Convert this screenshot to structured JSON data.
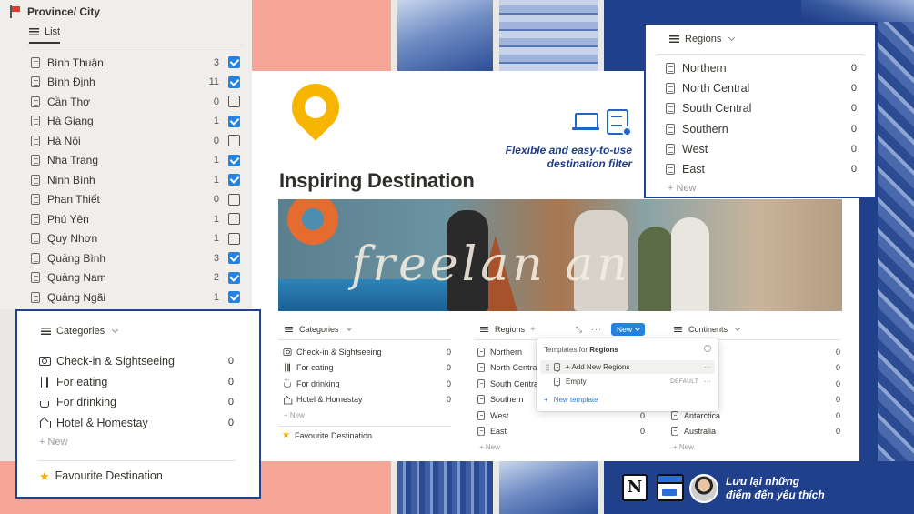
{
  "sidebar": {
    "title": "Province/ City",
    "tab": "List",
    "items": [
      {
        "name": "Bình Thuận",
        "count": "3",
        "checked": true
      },
      {
        "name": "Bình Định",
        "count": "11",
        "checked": true
      },
      {
        "name": "Cần Thơ",
        "count": "0",
        "checked": false
      },
      {
        "name": "Hà Giang",
        "count": "1",
        "checked": true
      },
      {
        "name": "Hà Nội",
        "count": "0",
        "checked": false
      },
      {
        "name": "Nha Trang",
        "count": "1",
        "checked": true
      },
      {
        "name": "Ninh Bình",
        "count": "1",
        "checked": true
      },
      {
        "name": "Phan Thiết",
        "count": "0",
        "checked": false
      },
      {
        "name": "Phú Yên",
        "count": "1",
        "checked": false
      },
      {
        "name": "Quy Nhơn",
        "count": "1",
        "checked": false
      },
      {
        "name": "Quảng Bình",
        "count": "3",
        "checked": true
      },
      {
        "name": "Quảng Nam",
        "count": "2",
        "checked": true
      },
      {
        "name": "Quảng Ngãi",
        "count": "1",
        "checked": true
      }
    ]
  },
  "categories_panel": {
    "title": "Categories",
    "items": [
      {
        "icon": "camera-icon",
        "name": "Check-in & Sightseeing",
        "count": "0"
      },
      {
        "icon": "fork-icon",
        "name": "For eating",
        "count": "0"
      },
      {
        "icon": "cup-icon",
        "name": "For drinking",
        "count": "0"
      },
      {
        "icon": "house-icon",
        "name": "Hotel & Homestay",
        "count": "0"
      }
    ],
    "new_label": "+ New",
    "favourite": "Favourite Destination"
  },
  "card": {
    "title": "Inspiring Destination",
    "tagline_1": "Flexible and easy-to-use",
    "tagline_2": "destination filter",
    "banner_text": "freelan     an"
  },
  "columns": {
    "categories": {
      "title": "Categories",
      "items": [
        {
          "icon": "camera-icon",
          "name": "Check-in & Sightseeing",
          "count": "0"
        },
        {
          "icon": "fork-icon",
          "name": "For eating",
          "count": "0"
        },
        {
          "icon": "cup-icon",
          "name": "For drinking",
          "count": "0"
        },
        {
          "icon": "house-icon",
          "name": "Hotel & Homestay",
          "count": "0"
        }
      ],
      "new_label": "+ New",
      "favourite": "Favourite Destination"
    },
    "regions": {
      "title": "Regions",
      "plus": "+",
      "expand": "⤡",
      "more": "···",
      "new_button": "New",
      "items": [
        {
          "name": "Northern",
          "count": ""
        },
        {
          "name": "North Central",
          "count": ""
        },
        {
          "name": "South Central",
          "count": ""
        },
        {
          "name": "Southern",
          "count": ""
        },
        {
          "name": "West",
          "count": "0"
        },
        {
          "name": "East",
          "count": "0"
        }
      ],
      "new_label": "+ New"
    },
    "continents": {
      "title": "Continents",
      "items": [
        {
          "name": "",
          "count": "0"
        },
        {
          "name": "",
          "count": "0"
        },
        {
          "name": "",
          "count": "0"
        },
        {
          "name": "",
          "count": "0"
        },
        {
          "name": "Antarctica",
          "count": "0"
        },
        {
          "name": "Australia",
          "count": "0"
        }
      ],
      "new_label": "+ New"
    }
  },
  "templates": {
    "heading_prefix": "Templates for",
    "heading_target": "Regions",
    "help": "?",
    "rows": [
      {
        "name": "+ Add New Regions",
        "badge": "",
        "dots": "···"
      },
      {
        "name": "Empty",
        "badge": "DEFAULT",
        "dots": "···"
      }
    ],
    "new_template": "New template",
    "new_plus": "+"
  },
  "regions_panel": {
    "title": "Regions",
    "items": [
      {
        "name": "Northern",
        "count": "0"
      },
      {
        "name": "North Central",
        "count": "0"
      },
      {
        "name": "South Central",
        "count": "0"
      },
      {
        "name": "Southern",
        "count": "0"
      },
      {
        "name": "West",
        "count": "0"
      },
      {
        "name": "East",
        "count": "0"
      }
    ],
    "new_label": "+ New"
  },
  "footer": {
    "notion_glyph": "N",
    "line_1": "Lưu lại những",
    "line_2": "điểm đến  yêu thích"
  },
  "colors": {
    "accent_blue": "#2383e2",
    "navy": "#20408c",
    "salmon": "#f6a597",
    "pin_yellow": "#f7b500"
  }
}
